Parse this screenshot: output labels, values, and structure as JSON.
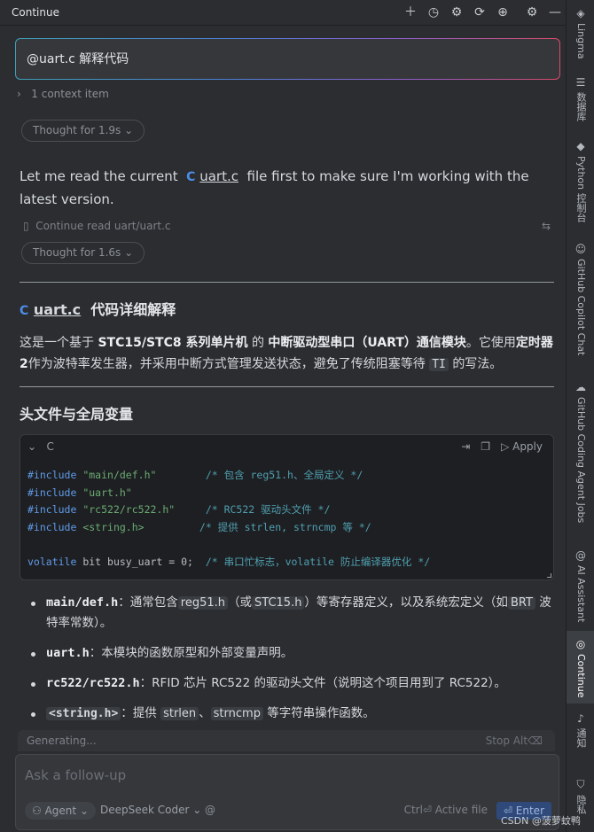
{
  "topbar": {
    "title": "Continue",
    "icons": [
      "plus-icon",
      "history-icon",
      "gear-icon",
      "refresh-icon",
      "globe-icon",
      "settings-icon",
      "minimize-icon"
    ]
  },
  "right_strip": {
    "items": [
      {
        "icon": "lingma-icon",
        "label": "Lingma"
      },
      {
        "icon": "database-icon",
        "label": "数据库"
      },
      {
        "icon": "python-icon",
        "label": "Python 控制台"
      },
      {
        "icon": "copilot-icon",
        "label": "GitHub Copilot Chat"
      },
      {
        "icon": "cloud-icon",
        "label": "GitHub Coding Agent Jobs"
      },
      {
        "icon": "at-icon",
        "label": "AI Assistant"
      },
      {
        "icon": "continue-icon",
        "label": "Continue"
      },
      {
        "icon": "bell-icon",
        "label": "通知"
      },
      {
        "icon": "shield-icon",
        "label": "隐私"
      }
    ]
  },
  "prompt": {
    "text": "@uart.c 解释代码"
  },
  "context": {
    "label": "1 context item"
  },
  "thoughts": {
    "first": "Thought for 1.9s",
    "second": "Thought for 1.6s"
  },
  "intro": {
    "prefix": "Let me read the current",
    "chip_letter": "C",
    "file": "uart.c",
    "suffix": "file first to make sure I'm working with the latest version."
  },
  "read_status": {
    "text": "Continue read uart/uart.c"
  },
  "heading1": {
    "chip_letter": "C",
    "file": "uart.c",
    "rest": "代码详细解释"
  },
  "summary": {
    "p1": "这是一个基于",
    "b1": "STC15/STC8 系列单片机",
    "p2": "的",
    "b2": "中断驱动型串口（UART）通信模块",
    "p3": "。它使用",
    "b3": "定时器2",
    "p4": "作为波特率发生器，并采用中断方式管理发送状态，避免了传统阻塞等待",
    "code": "TI",
    "p5": "的写法。"
  },
  "heading2": "头文件与全局变量",
  "codeblock": {
    "lang": "C",
    "apply": "Apply",
    "lines": [
      {
        "kw": "#include",
        "str": "\"main/def.h\"",
        "pad": "        ",
        "cmt": "/* 包含 reg51.h、全局定义 */"
      },
      {
        "kw": "#include",
        "str": "\"uart.h\"",
        "pad": "",
        "cmt": ""
      },
      {
        "kw": "#include",
        "str": "\"rc522/rc522.h\"",
        "pad": "     ",
        "cmt": "/* RC522 驱动头文件 */"
      },
      {
        "kw": "#include",
        "str": "<string.h>",
        "pad": "         ",
        "cmt": "/* 提供 strlen, strncmp 等 */"
      },
      {
        "kw": "",
        "str": "",
        "pad": "",
        "cmt": ""
      },
      {
        "kw": "volatile",
        "str": "bit busy_uart = 0;",
        "pad": "  ",
        "cmt": "/* 串口忙标志，volatile 防止编译器优化 */"
      }
    ]
  },
  "bullets": [
    {
      "name": "main/def.h",
      "pre": "：通常包含",
      "c1": "reg51.h",
      "mid": "（或",
      "c2": "STC15.h",
      "post": "）等寄存器定义，以及系统宏定义（如",
      "c3": "BRT",
      "end": "波特率常数）。"
    },
    {
      "name": "uart.h",
      "text": "：本模块的函数原型和外部变量声明。"
    },
    {
      "name": "rc522/rc522.h",
      "text": "：RFID 芯片 RC522 的驱动头文件（说明这个项目用到了 RC522）。"
    },
    {
      "name": "<string.h>",
      "pre": "：提供",
      "c1": "strlen",
      "mid": "、",
      "c2": "strncmp",
      "end": "等字符串操作函数。"
    }
  ],
  "generating": {
    "label": "Generating...",
    "stop": "Stop Alt⌫"
  },
  "followup": {
    "placeholder": "Ask a follow-up",
    "agent": "Agent",
    "model": "DeepSeek Coder",
    "at": "@",
    "active_file": "Ctrl⏎ Active file",
    "enter": "⏎ Enter"
  },
  "watermark": "CSDN @菠萝蚊鸭",
  "colors": {
    "background": "#2b2d30",
    "accent_blue": "#4b8de8",
    "keyword": "#5f9be8",
    "string": "#6aab73",
    "comment": "#4f9fb0"
  }
}
